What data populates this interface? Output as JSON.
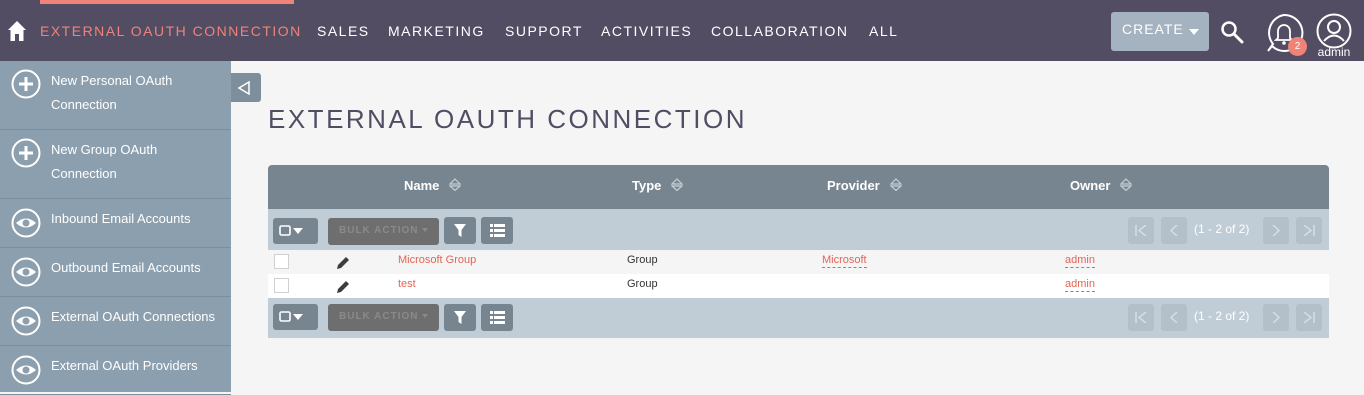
{
  "nav": {
    "items": [
      {
        "label": "EXTERNAL OAUTH CONNECTION",
        "active": true
      },
      {
        "label": "SALES"
      },
      {
        "label": "MARKETING"
      },
      {
        "label": "SUPPORT"
      },
      {
        "label": "ACTIVITIES"
      },
      {
        "label": "COLLABORATION"
      },
      {
        "label": "ALL"
      }
    ],
    "create_label": "CREATE",
    "notification_count": "2",
    "user_label": "admin",
    "icons": [
      "home-icon",
      "search-icon",
      "bell-icon",
      "user-avatar-icon"
    ]
  },
  "sidebar": {
    "items": [
      {
        "label": "New Personal OAuth Connection",
        "icon": "plus-circle-icon"
      },
      {
        "label": "New Group OAuth Connection",
        "icon": "plus-circle-icon"
      },
      {
        "label": "Inbound Email Accounts",
        "icon": "eye-icon"
      },
      {
        "label": "Outbound Email Accounts",
        "icon": "eye-icon"
      },
      {
        "label": "External OAuth Connections",
        "icon": "eye-icon"
      },
      {
        "label": "External OAuth Providers",
        "icon": "eye-icon"
      }
    ]
  },
  "page": {
    "title": "EXTERNAL OAUTH CONNECTION"
  },
  "table": {
    "columns": [
      "Name",
      "Type",
      "Provider",
      "Owner"
    ],
    "bulk_action_label": "BULK ACTION",
    "pagination": "(1 - 2 of 2)",
    "rows": [
      {
        "name": "Microsoft Group",
        "type": "Group",
        "provider": "Microsoft",
        "owner": "admin"
      },
      {
        "name": "test",
        "type": "Group",
        "provider": "",
        "owner": "admin"
      }
    ]
  },
  "colors": {
    "topbar": "#534d64",
    "accent": "#f08377",
    "sidebar": "#8c9fae",
    "table_header": "#778591",
    "action_bar": "#c1cdd6"
  }
}
